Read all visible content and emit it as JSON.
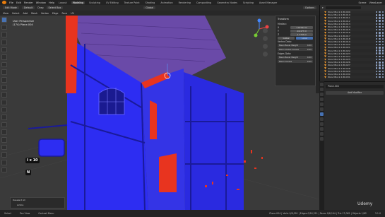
{
  "menubar": {
    "items": [
      "File",
      "Edit",
      "Render",
      "Window",
      "Help"
    ],
    "workspaces": [
      "Layout",
      "Modeling",
      "Sculpting",
      "UV Editing",
      "Texture Paint",
      "Shading",
      "Animation",
      "Rendering",
      "Compositing",
      "Geometry Nodes",
      "Scripting",
      "Asset Manager"
    ],
    "active_workspace": "Modeling",
    "scene_label": "Scene",
    "view_layer_label": "ViewLayer"
  },
  "viewport_header": {
    "mode": "Edit Mode",
    "orientation": "Default",
    "drag": "Drag",
    "select": "Select Box",
    "transform": "Global",
    "options": "Options"
  },
  "viewport_menu": [
    "View",
    "Select",
    "Add",
    "Mesh",
    "Vertex",
    "Edge",
    "Face",
    "UV"
  ],
  "overlay": {
    "line1": "User Perspective",
    "line2": "(174) Plane.004"
  },
  "npanel": {
    "title": "Transform",
    "median_label": "Median:",
    "x_label": "X",
    "x_value": "1.67742 m",
    "y_label": "Y",
    "y_value": "-0.4177 m",
    "z_label": "Z",
    "z_value": "-1.7733 m",
    "global_label": "Global",
    "local_label": "Local",
    "vertex_data_label": "Vertex Data:",
    "bevel_weight_label": "Mean Bevel Weight",
    "bevel_weight_value": "0.00",
    "crease_label": "Mean Vertex Crease",
    "crease_value": "0.00",
    "edge_data_label": "Edges Data:",
    "edge_bevel_label": "Mean Bevel Weight",
    "edge_bevel_value": "0.00",
    "edge_crease_label": "Mean Crease",
    "edge_crease_value": "0.00"
  },
  "keystrokes": {
    "combo": "I x 10",
    "key": "N"
  },
  "last_operator": {
    "title": "Deselect All",
    "row": "Action"
  },
  "statusbar": {
    "select": "Select",
    "pan_view": "Pan View",
    "context_menu": "Context Menu",
    "stats": "Plane.004 | Verts 0/8,091 | Edges 0/16,311 | Faces 0/8,194 | Tris 17,062 | Objects 1/62",
    "version": "3.1.0"
  },
  "outliner": {
    "items": [
      "Wood Block 2.86.009",
      "Wood Block 2.86.010",
      "Wood Block 2.86.011",
      "Wood Block 2.86.012",
      "Wood Block 2.86.013",
      "Wood Block 2.86.014",
      "Wood Block 2.86.015",
      "Wood Block 2.86.016",
      "Wood Block 2.86.017",
      "Wood Block 2.86.018",
      "Wood Block 2.86.019",
      "Wood Block 2.86.020",
      "Wood Block 2.86.021",
      "Wood Block 2.86.022",
      "Wood Block 2.86.023",
      "Wood Block 2.86.024",
      "Wood Block 2.86.025",
      "Wood Block 2.86.026",
      "Wood Block 2.86.027",
      "Wood Block 2.86.028",
      "Wood Block 2.86.029",
      "Wood Block 2.86.030",
      "Wood Block 2.86.031"
    ]
  },
  "properties": {
    "object_name": "Plane.004",
    "add_modifier": "Add Modifier"
  },
  "watermark": "Udemy",
  "colors": {
    "accent": "#4772b3",
    "mesh_blue": "#2d2df2",
    "selection_red": "#e8341f",
    "outliner_orange": "#f29a2e"
  }
}
